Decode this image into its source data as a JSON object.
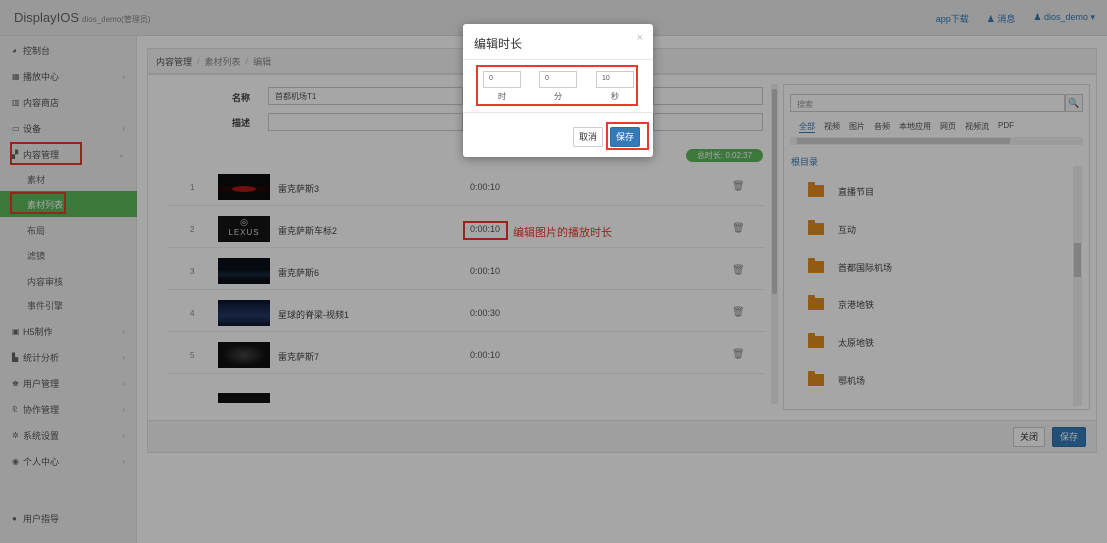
{
  "app": {
    "brand": "DisplayIOS",
    "brand_sub": "dios_demo(管理员)",
    "top_links": {
      "download": "app下载",
      "messages": "消息",
      "user": "dios_demo ▾"
    }
  },
  "sidebar": {
    "items": [
      {
        "label": "控制台",
        "icon": "dashboard-icon"
      },
      {
        "label": "播放中心",
        "icon": "grid-icon",
        "chevron": "‹"
      },
      {
        "label": "内容商店",
        "icon": "store-icon"
      },
      {
        "label": "设备",
        "icon": "monitor-icon",
        "chevron": "‹"
      },
      {
        "label": "内容管理",
        "icon": "content-icon",
        "chevron": "⌄"
      },
      {
        "label": "素材"
      },
      {
        "label": "素材列表"
      },
      {
        "label": "布局"
      },
      {
        "label": "滤镜"
      },
      {
        "label": "内容审核"
      },
      {
        "label": "事件引擎"
      },
      {
        "label": "H5制作",
        "icon": "h5-icon",
        "chevron": "‹"
      },
      {
        "label": "统计分析",
        "icon": "chart-icon",
        "chevron": "‹"
      },
      {
        "label": "用户管理",
        "icon": "users-icon",
        "chevron": "‹"
      },
      {
        "label": "协作管理",
        "icon": "collab-icon",
        "chevron": "‹"
      },
      {
        "label": "系统设置",
        "icon": "gear-icon",
        "chevron": "‹"
      },
      {
        "label": "个人中心",
        "icon": "person-icon",
        "chevron": "‹"
      }
    ],
    "guide": "用户指导"
  },
  "breadcrumb": {
    "c1": "内容管理",
    "c2": "素材列表",
    "c3": "编辑"
  },
  "form": {
    "name_label": "名称",
    "name_value": "首都机场T1",
    "desc_label": "描述",
    "desc_value": "",
    "total_time": "总时长: 0:02:37"
  },
  "playlist": {
    "rows": [
      {
        "index": "1",
        "name": "雷克萨斯3",
        "duration": "0:00:10"
      },
      {
        "index": "2",
        "name": "雷克萨斯车标2",
        "duration": "0:00:10",
        "thumb_text": "LEXUS"
      },
      {
        "index": "3",
        "name": "雷克萨斯6",
        "duration": "0:00:10"
      },
      {
        "index": "4",
        "name": "星球的脊梁-视频1",
        "duration": "0:00:30"
      },
      {
        "index": "5",
        "name": "雷克萨斯7",
        "duration": "0:00:10"
      }
    ],
    "trash_icon": "🗑"
  },
  "annotation": {
    "text": "编辑图片的播放时长"
  },
  "library": {
    "search_placeholder": "搜索",
    "search_btn": "🔍",
    "tabs": [
      "全部",
      "视频",
      "图片",
      "音频",
      "本地应用",
      "网页",
      "视频流",
      "PDF"
    ],
    "root": "根目录",
    "folders": [
      "直播节目",
      "互动",
      "首都国际机场",
      "京港地铁",
      "太原地铁",
      "鄂机场"
    ]
  },
  "bottom": {
    "close": "关闭",
    "save": "保存"
  },
  "modal": {
    "title": "编辑时长",
    "close": "×",
    "hours": "0",
    "hours_unit": "时",
    "minutes": "0",
    "minutes_unit": "分",
    "seconds": "10",
    "seconds_unit": "秒",
    "cancel": "取消",
    "save": "保存"
  },
  "colors": {
    "accent_green": "#5cb85c",
    "primary_blue": "#337ab7",
    "annotation_red": "#e53b2c",
    "folder_orange": "#e08a1e"
  }
}
